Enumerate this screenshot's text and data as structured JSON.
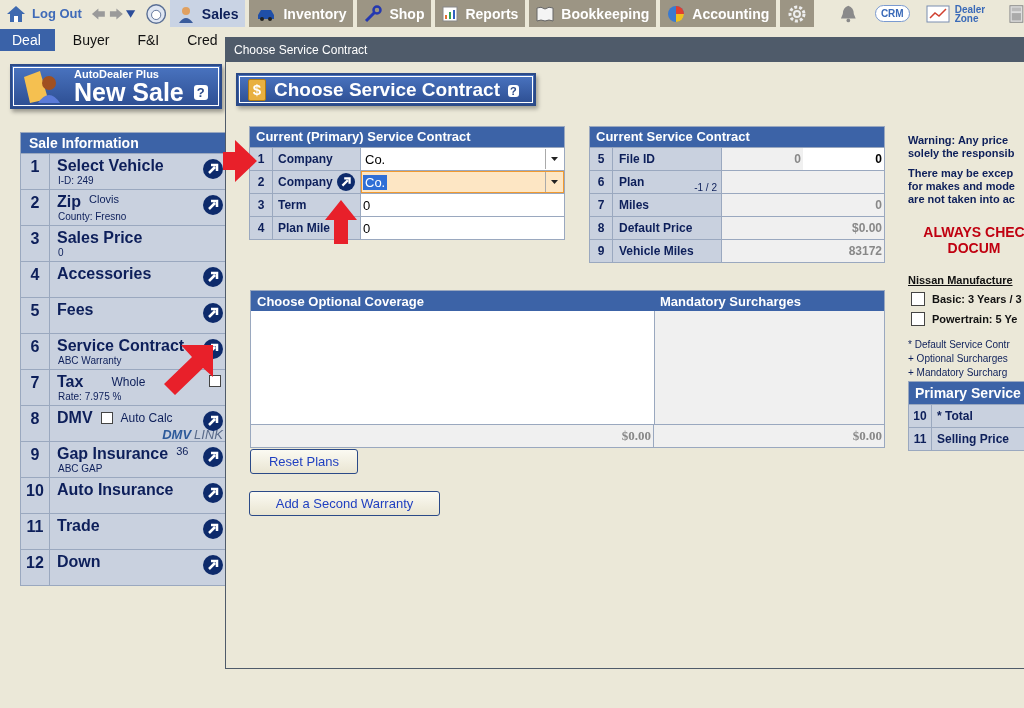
{
  "top_nav": {
    "logout": "Log Out",
    "tabs": [
      {
        "label": "Sales",
        "selected": true
      },
      {
        "label": "Inventory",
        "selected": false
      },
      {
        "label": "Shop",
        "selected": false
      },
      {
        "label": "Reports",
        "selected": false
      },
      {
        "label": "Bookkeeping",
        "selected": false
      },
      {
        "label": "Accounting",
        "selected": false
      },
      {
        "selected": false
      }
    ],
    "crm": "CRM",
    "dealer_zone": [
      "Dealer",
      "Zone"
    ]
  },
  "sub_tabs": [
    {
      "label": "Deal",
      "selected": true
    },
    {
      "label": "Buyer",
      "selected": false
    },
    {
      "label": "F&I",
      "selected": false
    },
    {
      "label": "Cred",
      "selected": false
    }
  ],
  "banner": {
    "subtitle": "AutoDealer Plus",
    "title": "New Sale",
    "help": "?"
  },
  "sale_info": {
    "header": "Sale Information",
    "items": [
      {
        "num": "1",
        "kind": "plain",
        "title": "Select Vehicle",
        "sub": "I-D:  249",
        "link": true
      },
      {
        "num": "2",
        "kind": "plain",
        "title": "Zip",
        "extra": "Clovis",
        "sub": "County: Fresno",
        "link": true
      },
      {
        "num": "3",
        "kind": "plain",
        "title": "Sales Price",
        "sub": "0",
        "link": false
      },
      {
        "num": "4",
        "kind": "plain",
        "title": "Accessories",
        "link": true
      },
      {
        "num": "5",
        "kind": "plain",
        "title": "Fees",
        "link": true
      },
      {
        "num": "6",
        "kind": "plain",
        "title": "Service Contract",
        "sub": "ABC Warranty",
        "link": true
      },
      {
        "num": "7",
        "kind": "tax",
        "title": "Tax",
        "check_label": "Whole",
        "checked": false,
        "sub": "Rate: 7.975 %",
        "link": false
      },
      {
        "num": "8",
        "kind": "dmv",
        "title": "DMV",
        "check_label": "Auto Calc",
        "checked": false,
        "logo": [
          "DMV",
          "LINK"
        ],
        "link": true
      },
      {
        "num": "9",
        "kind": "plain",
        "title": "Gap Insurance",
        "extra": "36",
        "sub": "ABC GAP",
        "link": true
      },
      {
        "num": "10",
        "kind": "plain",
        "title": "Auto Insurance",
        "link": true
      },
      {
        "num": "11",
        "kind": "plain",
        "title": "Trade",
        "link": true
      },
      {
        "num": "12",
        "kind": "plain",
        "title": "Down",
        "link": true
      }
    ]
  },
  "modal": {
    "title": "Choose Service Contract",
    "banner_icon": "$",
    "banner": "Choose Service Contract",
    "help": "?",
    "primary": {
      "header": "Current (Primary) Service Contract",
      "rows": [
        {
          "num": "1",
          "label": "Company",
          "link": false,
          "kind": "select",
          "value": "Co.",
          "focused": false
        },
        {
          "num": "2",
          "label": "Company",
          "link": true,
          "kind": "select",
          "value": "Co.",
          "focused": true
        },
        {
          "num": "3",
          "label": "Term",
          "link": false,
          "kind": "input",
          "value": "0"
        },
        {
          "num": "4",
          "label": "Plan Mile",
          "link": false,
          "kind": "input",
          "value": "0"
        }
      ]
    },
    "current": {
      "header": "Current Service Contract",
      "rows": [
        {
          "num": "5",
          "label": "File ID",
          "kind": "split",
          "values": [
            "0",
            "0"
          ]
        },
        {
          "num": "6",
          "label": "Plan",
          "kind": "note",
          "note": "-1 / 2"
        },
        {
          "num": "7",
          "label": "Miles",
          "kind": "value",
          "value": "0"
        },
        {
          "num": "8",
          "label": "Default Price",
          "kind": "value",
          "value": "$0.00"
        },
        {
          "num": "9",
          "label": "Vehicle Miles",
          "kind": "value",
          "value": "83172"
        }
      ]
    },
    "coverage": {
      "headers": [
        "Choose Optional Coverage",
        "Mandatory Surcharges"
      ],
      "totals": [
        "$0.00",
        "$0.00"
      ]
    },
    "buttons": [
      "Reset Plans",
      "Add a Second Warranty"
    ],
    "notes": {
      "warning": [
        "Warning:  Any price",
        "solely the responsib"
      ],
      "exceptions": [
        "There may be excep",
        "for makes and mode",
        "are not taken into ac"
      ],
      "alert": [
        "ALWAYS CHEC",
        "DOCUM"
      ],
      "manufacturer": "Nissan Manufacture",
      "options": [
        {
          "label": "Basic: 3 Years / 3",
          "checked": false
        },
        {
          "label": "Powertrain: 5 Ye",
          "checked": false
        }
      ],
      "footnotes": [
        "* Default Service Contr",
        "+ Optional Surcharges",
        "+ Mandatory Surcharg"
      ],
      "summary": {
        "header": "Primary Service",
        "rows": [
          {
            "num": "10",
            "label": "* Total"
          },
          {
            "num": "11",
            "label": "Selling Price"
          }
        ]
      }
    }
  }
}
